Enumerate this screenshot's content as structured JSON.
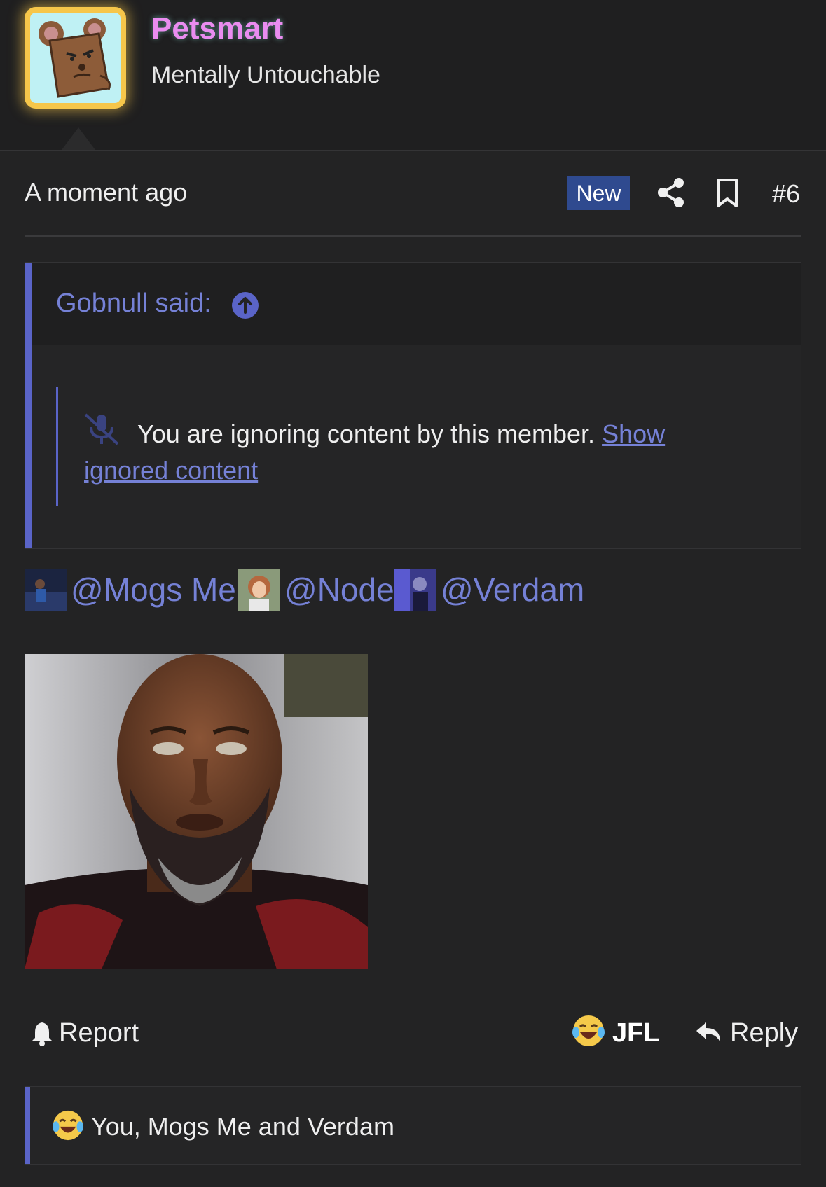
{
  "header": {
    "username": "Petsmart",
    "user_title": "Mentally Untouchable",
    "avatar_icon": "angry-cartoon-mouse-avatar"
  },
  "post": {
    "time": "A moment ago",
    "new_badge": "New",
    "share_icon": "share-icon",
    "bookmark_icon": "bookmark-icon",
    "post_number": "#6"
  },
  "quote": {
    "author": "Gobnull said:",
    "ignored_message": "You are ignoring content by this member.",
    "show_link": "Show ignored content"
  },
  "mentions": [
    {
      "name": "@Mogs Me"
    },
    {
      "name": "@Node"
    },
    {
      "name": "@Verdam"
    }
  ],
  "actions": {
    "report": "Report",
    "reaction": "JFL",
    "reply": "Reply"
  },
  "reactions": {
    "summary": "You, Mogs Me and Verdam"
  },
  "colors": {
    "accent": "#5a64c8",
    "link": "#7581d6",
    "username": "#ea8cf0",
    "badge": "#2f4a8f",
    "background": "#232324"
  }
}
